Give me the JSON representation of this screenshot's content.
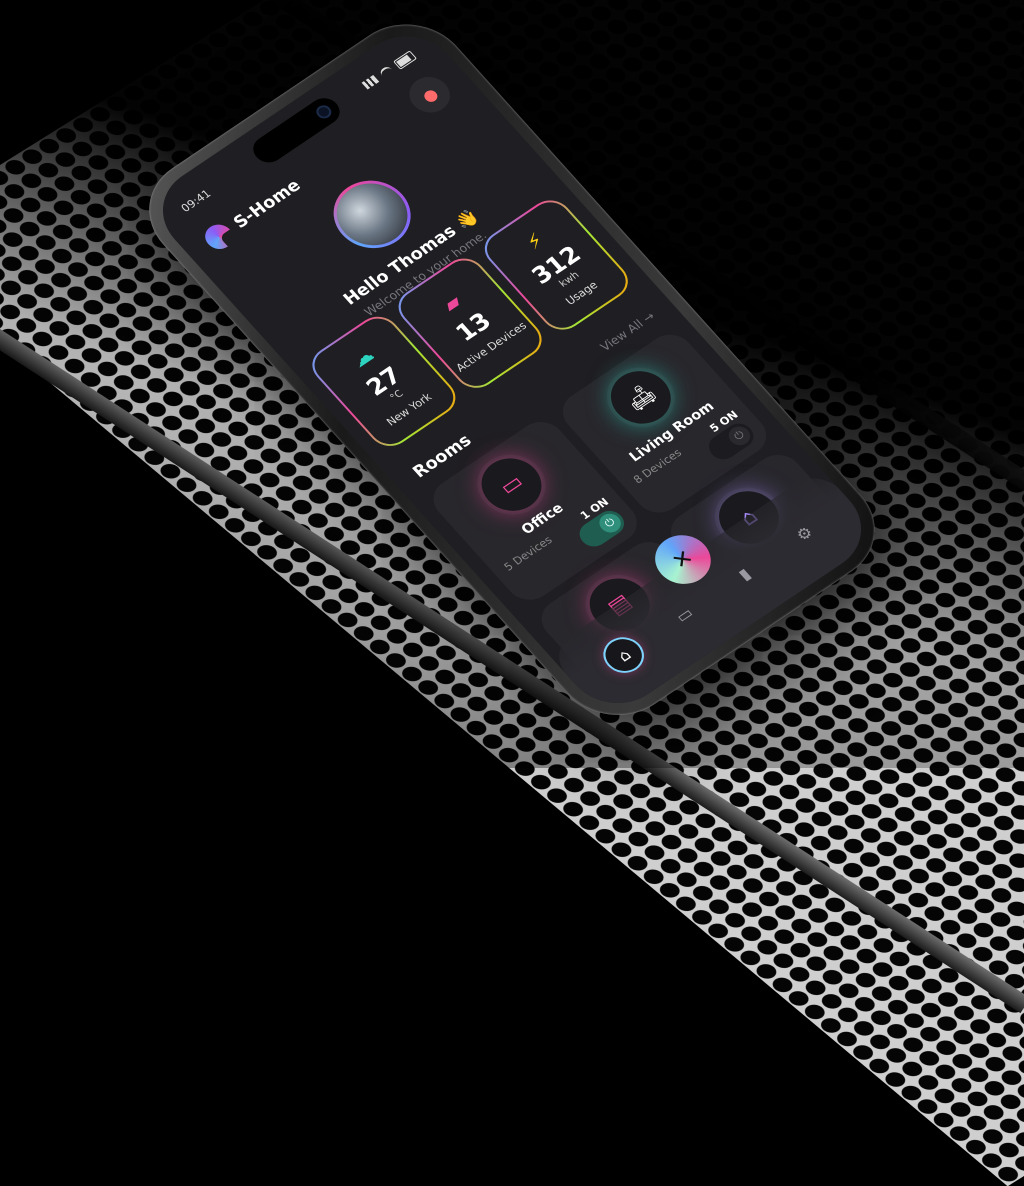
{
  "status": {
    "time": "09:41"
  },
  "app": {
    "name": "S-Home"
  },
  "user": {
    "greeting": "Hello Thomas",
    "wave": "👋",
    "welcome": "Welcome to your home."
  },
  "stats": [
    {
      "icon": "☁",
      "value": "27",
      "unit": "°C",
      "label": "New York",
      "color": "#2dd4bf"
    },
    {
      "icon": "▰",
      "value": "13",
      "unit": "",
      "label": "Active Devices",
      "color": "#ec4899"
    },
    {
      "icon": "⚡",
      "value": "312",
      "unit": "kwh",
      "label": "Usage",
      "color": "#facc15"
    }
  ],
  "rooms_section": {
    "title": "Rooms",
    "view_all": "View All →"
  },
  "rooms": [
    {
      "name": "Office",
      "devices": "5 Devices",
      "on": "1 ON",
      "icon": "▭",
      "glow": "pink",
      "power_on": true
    },
    {
      "name": "Living Room",
      "devices": "8 Devices",
      "on": "5 ON",
      "icon": "🛋",
      "glow": "teal",
      "power_on": false
    },
    {
      "name": "",
      "devices": "",
      "on": "",
      "icon": "▤",
      "glow": "pink",
      "power_on": false
    },
    {
      "name": "",
      "devices": "",
      "on": "",
      "icon": "⌂",
      "glow": "violet",
      "power_on": false
    }
  ],
  "nav": {
    "home": "⌂",
    "devices": "▭",
    "fab": "✕",
    "stats": "▮",
    "settings": "⚙"
  }
}
